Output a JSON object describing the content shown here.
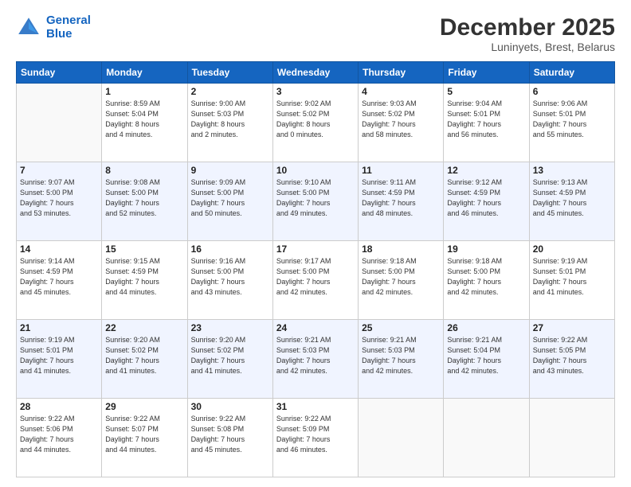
{
  "logo": {
    "line1": "General",
    "line2": "Blue"
  },
  "title": "December 2025",
  "subtitle": "Luninyets, Brest, Belarus",
  "days_header": [
    "Sunday",
    "Monday",
    "Tuesday",
    "Wednesday",
    "Thursday",
    "Friday",
    "Saturday"
  ],
  "weeks": [
    [
      {
        "num": "",
        "info": ""
      },
      {
        "num": "1",
        "info": "Sunrise: 8:59 AM\nSunset: 5:04 PM\nDaylight: 8 hours\nand 4 minutes."
      },
      {
        "num": "2",
        "info": "Sunrise: 9:00 AM\nSunset: 5:03 PM\nDaylight: 8 hours\nand 2 minutes."
      },
      {
        "num": "3",
        "info": "Sunrise: 9:02 AM\nSunset: 5:02 PM\nDaylight: 8 hours\nand 0 minutes."
      },
      {
        "num": "4",
        "info": "Sunrise: 9:03 AM\nSunset: 5:02 PM\nDaylight: 7 hours\nand 58 minutes."
      },
      {
        "num": "5",
        "info": "Sunrise: 9:04 AM\nSunset: 5:01 PM\nDaylight: 7 hours\nand 56 minutes."
      },
      {
        "num": "6",
        "info": "Sunrise: 9:06 AM\nSunset: 5:01 PM\nDaylight: 7 hours\nand 55 minutes."
      }
    ],
    [
      {
        "num": "7",
        "info": "Sunrise: 9:07 AM\nSunset: 5:00 PM\nDaylight: 7 hours\nand 53 minutes."
      },
      {
        "num": "8",
        "info": "Sunrise: 9:08 AM\nSunset: 5:00 PM\nDaylight: 7 hours\nand 52 minutes."
      },
      {
        "num": "9",
        "info": "Sunrise: 9:09 AM\nSunset: 5:00 PM\nDaylight: 7 hours\nand 50 minutes."
      },
      {
        "num": "10",
        "info": "Sunrise: 9:10 AM\nSunset: 5:00 PM\nDaylight: 7 hours\nand 49 minutes."
      },
      {
        "num": "11",
        "info": "Sunrise: 9:11 AM\nSunset: 4:59 PM\nDaylight: 7 hours\nand 48 minutes."
      },
      {
        "num": "12",
        "info": "Sunrise: 9:12 AM\nSunset: 4:59 PM\nDaylight: 7 hours\nand 46 minutes."
      },
      {
        "num": "13",
        "info": "Sunrise: 9:13 AM\nSunset: 4:59 PM\nDaylight: 7 hours\nand 45 minutes."
      }
    ],
    [
      {
        "num": "14",
        "info": "Sunrise: 9:14 AM\nSunset: 4:59 PM\nDaylight: 7 hours\nand 45 minutes."
      },
      {
        "num": "15",
        "info": "Sunrise: 9:15 AM\nSunset: 4:59 PM\nDaylight: 7 hours\nand 44 minutes."
      },
      {
        "num": "16",
        "info": "Sunrise: 9:16 AM\nSunset: 5:00 PM\nDaylight: 7 hours\nand 43 minutes."
      },
      {
        "num": "17",
        "info": "Sunrise: 9:17 AM\nSunset: 5:00 PM\nDaylight: 7 hours\nand 42 minutes."
      },
      {
        "num": "18",
        "info": "Sunrise: 9:18 AM\nSunset: 5:00 PM\nDaylight: 7 hours\nand 42 minutes."
      },
      {
        "num": "19",
        "info": "Sunrise: 9:18 AM\nSunset: 5:00 PM\nDaylight: 7 hours\nand 42 minutes."
      },
      {
        "num": "20",
        "info": "Sunrise: 9:19 AM\nSunset: 5:01 PM\nDaylight: 7 hours\nand 41 minutes."
      }
    ],
    [
      {
        "num": "21",
        "info": "Sunrise: 9:19 AM\nSunset: 5:01 PM\nDaylight: 7 hours\nand 41 minutes."
      },
      {
        "num": "22",
        "info": "Sunrise: 9:20 AM\nSunset: 5:02 PM\nDaylight: 7 hours\nand 41 minutes."
      },
      {
        "num": "23",
        "info": "Sunrise: 9:20 AM\nSunset: 5:02 PM\nDaylight: 7 hours\nand 41 minutes."
      },
      {
        "num": "24",
        "info": "Sunrise: 9:21 AM\nSunset: 5:03 PM\nDaylight: 7 hours\nand 42 minutes."
      },
      {
        "num": "25",
        "info": "Sunrise: 9:21 AM\nSunset: 5:03 PM\nDaylight: 7 hours\nand 42 minutes."
      },
      {
        "num": "26",
        "info": "Sunrise: 9:21 AM\nSunset: 5:04 PM\nDaylight: 7 hours\nand 42 minutes."
      },
      {
        "num": "27",
        "info": "Sunrise: 9:22 AM\nSunset: 5:05 PM\nDaylight: 7 hours\nand 43 minutes."
      }
    ],
    [
      {
        "num": "28",
        "info": "Sunrise: 9:22 AM\nSunset: 5:06 PM\nDaylight: 7 hours\nand 44 minutes."
      },
      {
        "num": "29",
        "info": "Sunrise: 9:22 AM\nSunset: 5:07 PM\nDaylight: 7 hours\nand 44 minutes."
      },
      {
        "num": "30",
        "info": "Sunrise: 9:22 AM\nSunset: 5:08 PM\nDaylight: 7 hours\nand 45 minutes."
      },
      {
        "num": "31",
        "info": "Sunrise: 9:22 AM\nSunset: 5:09 PM\nDaylight: 7 hours\nand 46 minutes."
      },
      {
        "num": "",
        "info": ""
      },
      {
        "num": "",
        "info": ""
      },
      {
        "num": "",
        "info": ""
      }
    ]
  ]
}
